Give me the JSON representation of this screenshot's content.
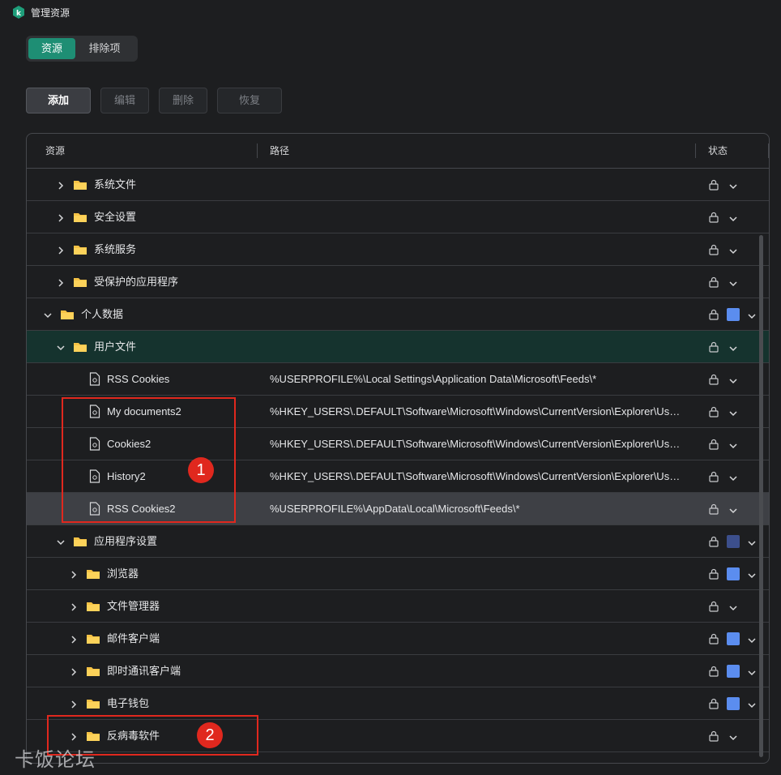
{
  "window": {
    "title": "管理资源"
  },
  "tabs": [
    {
      "label": "资源",
      "active": true
    },
    {
      "label": "排除项",
      "active": false
    }
  ],
  "toolbar": {
    "add": "添加",
    "edit": "编辑",
    "delete": "删除",
    "restore": "恢复"
  },
  "table": {
    "columns": {
      "resource": "资源",
      "path": "路径",
      "status": "状态"
    },
    "rows": [
      {
        "name": "系统文件",
        "path": "",
        "type": "folder",
        "level": 0,
        "expanded": false,
        "status_color": ""
      },
      {
        "name": "安全设置",
        "path": "",
        "type": "folder",
        "level": 0,
        "expanded": false,
        "status_color": ""
      },
      {
        "name": "系统服务",
        "path": "",
        "type": "folder",
        "level": 0,
        "expanded": false,
        "status_color": ""
      },
      {
        "name": "受保护的应用程序",
        "path": "",
        "type": "folder",
        "level": 0,
        "expanded": false,
        "status_color": ""
      },
      {
        "name": "个人数据",
        "path": "",
        "type": "folder",
        "level": -1,
        "expanded": true,
        "status_color": "#5b8def"
      },
      {
        "name": "用户文件",
        "path": "",
        "type": "folder",
        "level": 0,
        "expanded": true,
        "status_color": "",
        "selected": true
      },
      {
        "name": "RSS Cookies",
        "path": "%USERPROFILE%\\Local Settings\\Application Data\\Microsoft\\Feeds\\*",
        "type": "file",
        "level": 1,
        "status_color": ""
      },
      {
        "name": "My documents2",
        "path": "%HKEY_USERS\\.DEFAULT\\Software\\Microsoft\\Windows\\CurrentVersion\\Explorer\\User Shell Folders\\Personal%",
        "type": "file",
        "level": 1,
        "status_color": ""
      },
      {
        "name": "Cookies2",
        "path": "%HKEY_USERS\\.DEFAULT\\Software\\Microsoft\\Windows\\CurrentVersion\\Explorer\\User Shell Folders\\Cookies%",
        "type": "file",
        "level": 1,
        "status_color": ""
      },
      {
        "name": "History2",
        "path": "%HKEY_USERS\\.DEFAULT\\Software\\Microsoft\\Windows\\CurrentVersion\\Explorer\\User Shell Folders\\History%",
        "type": "file",
        "level": 1,
        "status_color": ""
      },
      {
        "name": "RSS Cookies2",
        "path": "%USERPROFILE%\\AppData\\Local\\Microsoft\\Feeds\\*",
        "type": "file",
        "level": 1,
        "status_color": "",
        "highlight": true
      },
      {
        "name": "应用程序设置",
        "path": "",
        "type": "folder",
        "level": 0,
        "expanded": true,
        "status_color": "#3c4f8c"
      },
      {
        "name": "浏览器",
        "path": "",
        "type": "folder",
        "level": 1,
        "expanded": false,
        "status_color": "#5b8def"
      },
      {
        "name": "文件管理器",
        "path": "",
        "type": "folder",
        "level": 1,
        "expanded": false,
        "status_color": ""
      },
      {
        "name": "邮件客户端",
        "path": "",
        "type": "folder",
        "level": 1,
        "expanded": false,
        "status_color": "#5b8def"
      },
      {
        "name": "即时通讯客户端",
        "path": "",
        "type": "folder",
        "level": 1,
        "expanded": false,
        "status_color": "#5b8def"
      },
      {
        "name": "电子钱包",
        "path": "",
        "type": "folder",
        "level": 1,
        "expanded": false,
        "status_color": "#5b8def"
      },
      {
        "name": "反病毒软件",
        "path": "",
        "type": "folder",
        "level": 1,
        "expanded": false,
        "status_color": ""
      }
    ]
  },
  "annotations": [
    {
      "label": "1"
    },
    {
      "label": "2"
    }
  ],
  "watermark": "卡饭论坛",
  "colors": {
    "accent": "#1e8e74",
    "selected_row": "#15332e",
    "status_blue": "#5b8def",
    "annotation_red": "#e0281e"
  }
}
